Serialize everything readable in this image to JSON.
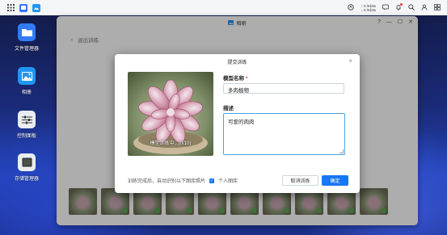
{
  "taskbar": {
    "net_up": "↑ 0 /Kbits",
    "net_down": "↓ 0 /Kbits"
  },
  "desktop": {
    "icons": [
      {
        "label": "文件管理器",
        "icon": "folder-icon",
        "color": "#2f7cf6"
      },
      {
        "label": "相册",
        "icon": "photos-icon",
        "color": "#2196f3"
      },
      {
        "label": "控制面板",
        "icon": "sliders-icon",
        "color": "#e9edf2"
      },
      {
        "label": "存储管理器",
        "icon": "storage-icon",
        "color": "#e9edf2"
      }
    ]
  },
  "window": {
    "title": "相册",
    "back_label": "退出训练",
    "controls": [
      "?",
      "—",
      "☐",
      "✕"
    ]
  },
  "modal": {
    "title": "提交训练",
    "close": "×",
    "photo_caption": "模型训练中...(0/10)",
    "name_label": "模型名称",
    "required_mark": "*",
    "name_value": "多肉植物",
    "desc_label": "描述",
    "desc_value": "可爱的肉肉",
    "footer_note": "训练完成后，自动识别以下图库照片",
    "checkbox_label": "个人图库",
    "checkbox_checked": true,
    "cancel_label": "取消训练",
    "ok_label": "确定"
  },
  "colors": {
    "accent": "#1877f2",
    "required": "#e53935"
  }
}
